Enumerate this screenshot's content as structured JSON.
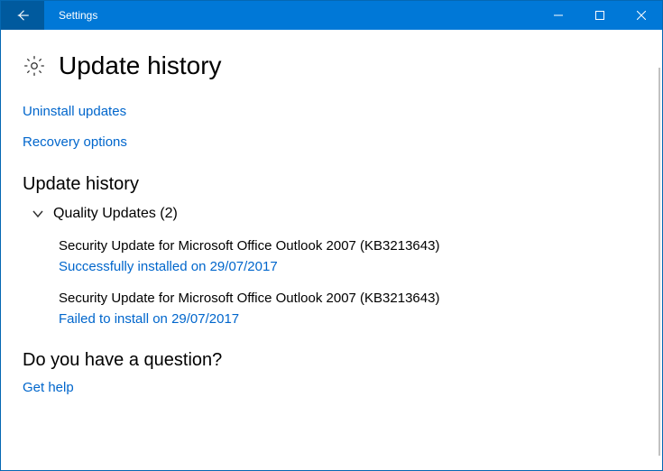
{
  "window": {
    "title": "Settings"
  },
  "page": {
    "heading": "Update history"
  },
  "links": {
    "uninstall": "Uninstall updates",
    "recovery": "Recovery options",
    "get_help": "Get help"
  },
  "sections": {
    "history_heading": "Update history",
    "question_heading": "Do you have a question?"
  },
  "group": {
    "label": "Quality Updates (2)"
  },
  "updates": [
    {
      "title": "Security Update for Microsoft Office Outlook 2007 (KB3213643)",
      "status": "Successfully installed on 29/07/2017"
    },
    {
      "title": "Security Update for Microsoft Office Outlook 2007 (KB3213643)",
      "status": "Failed to install on 29/07/2017"
    }
  ]
}
